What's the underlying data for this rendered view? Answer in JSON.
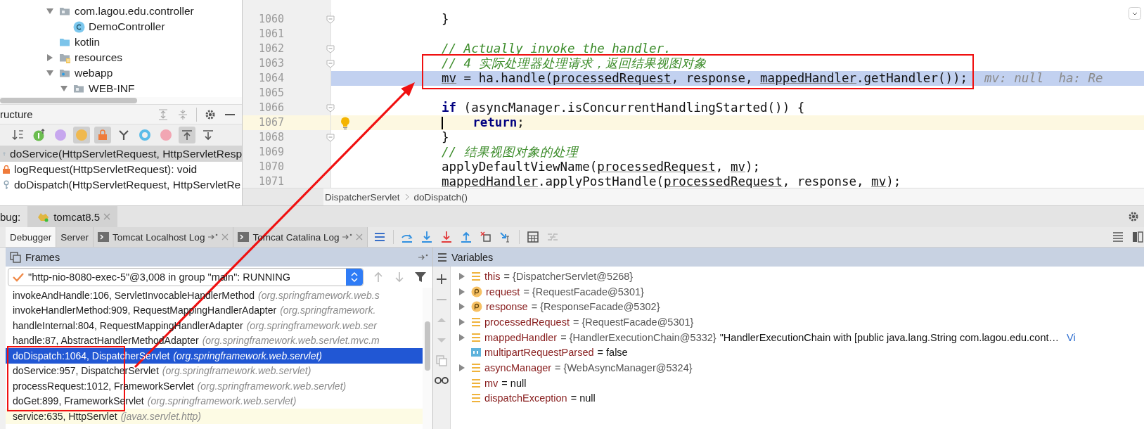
{
  "project_tree": {
    "items": [
      {
        "label": "com.lagou.edu.controller",
        "kind": "package",
        "expanded": true,
        "children": [
          {
            "label": "DemoController",
            "kind": "class"
          }
        ]
      },
      {
        "label": "kotlin",
        "kind": "folder"
      },
      {
        "label": "resources",
        "kind": "resources",
        "expanded": false
      },
      {
        "label": "webapp",
        "kind": "web",
        "expanded": true,
        "children": [
          {
            "label": "WEB-INF",
            "kind": "package",
            "expanded": true
          }
        ]
      }
    ]
  },
  "structure": {
    "title": "ructure",
    "toolbar": [
      {
        "kind": "sort",
        "on": false
      },
      {
        "kind": "inherited",
        "on": false
      },
      {
        "kind": "properties",
        "on": false
      },
      {
        "kind": "fields",
        "on": true
      },
      {
        "kind": "non-public",
        "on": true
      },
      {
        "kind": "anonymous",
        "on": false
      },
      {
        "kind": "interfaces",
        "on": false
      },
      {
        "kind": "lambdas",
        "on": false
      },
      {
        "kind": "scroll-to-source",
        "on": true
      },
      {
        "kind": "scroll-from-source",
        "on": false
      }
    ],
    "items": [
      {
        "label": "doService(HttpServletRequest, HttpServletResp",
        "kind": "package",
        "selected": true
      },
      {
        "label": "logRequest(HttpServletRequest): void",
        "kind": "private",
        "selected": false
      },
      {
        "label": "doDispatch(HttpServletRequest, HttpServletRe",
        "kind": "package",
        "selected": false
      }
    ]
  },
  "editor": {
    "lines": [
      {
        "number": "1060",
        "execution": false,
        "caret": false,
        "fold": true,
        "bulb": false,
        "annotated": false,
        "tokens": [
          {
            "text": "}",
            "kind": "plain"
          }
        ]
      },
      {
        "number": "1061",
        "execution": false,
        "caret": false,
        "fold": false,
        "bulb": false,
        "annotated": false
      },
      {
        "number": "1062",
        "execution": false,
        "caret": false,
        "fold": true,
        "bulb": false,
        "annotated": false,
        "tokens": [
          {
            "text": "// Actually invoke the handler.",
            "kind": "comment"
          }
        ]
      },
      {
        "number": "1063",
        "execution": false,
        "caret": false,
        "fold": true,
        "bulb": false,
        "annotated": true,
        "tokens": [
          {
            "text": "// 4 实际处理器处理请求，返回结果视图对象",
            "kind": "comment"
          }
        ]
      },
      {
        "number": "1064",
        "execution": true,
        "caret": false,
        "fold": false,
        "bulb": false,
        "annotated": true,
        "tokens": [
          {
            "text": "mv",
            "kind": "var"
          },
          {
            "text": " = ha.handle(",
            "kind": "plain"
          },
          {
            "text": "processedRequest",
            "kind": "var"
          },
          {
            "text": ", response, ",
            "kind": "plain"
          },
          {
            "text": "mappedHandler",
            "kind": "var"
          },
          {
            "text": ".getHandler());",
            "kind": "plain"
          }
        ],
        "hint": "mv: null  ha: Re"
      },
      {
        "number": "1065",
        "execution": false,
        "caret": false,
        "fold": false,
        "bulb": false,
        "annotated": false
      },
      {
        "number": "1066",
        "execution": false,
        "caret": false,
        "fold": true,
        "bulb": false,
        "annotated": false,
        "tokens": [
          {
            "text": "if",
            "kind": "keyword"
          },
          {
            "text": " (asyncManager.isConcurrentHandlingStarted()) {",
            "kind": "plain"
          }
        ]
      },
      {
        "number": "1067",
        "execution": false,
        "caret": true,
        "fold": false,
        "bulb": true,
        "annotated": false,
        "tokens": [
          {
            "text": "    return",
            "kind": "keyword"
          },
          {
            "text": ";",
            "kind": "plain"
          }
        ]
      },
      {
        "number": "1068",
        "execution": false,
        "caret": false,
        "fold": true,
        "bulb": false,
        "annotated": false,
        "tokens": [
          {
            "text": "}",
            "kind": "plain"
          }
        ]
      },
      {
        "number": "1069",
        "execution": false,
        "caret": false,
        "fold": false,
        "bulb": false,
        "annotated": false,
        "tokens": [
          {
            "text": "// 结果视图对象的处理",
            "kind": "comment"
          }
        ]
      },
      {
        "number": "1070",
        "execution": false,
        "caret": false,
        "fold": false,
        "bulb": false,
        "annotated": false,
        "tokens": [
          {
            "text": "applyDefaultViewName(",
            "kind": "plain"
          },
          {
            "text": "processedRequest",
            "kind": "var"
          },
          {
            "text": ", ",
            "kind": "plain"
          },
          {
            "text": "mv",
            "kind": "var"
          },
          {
            "text": ");",
            "kind": "plain"
          }
        ]
      },
      {
        "number": "1071",
        "execution": false,
        "caret": false,
        "fold": false,
        "bulb": false,
        "annotated": false,
        "tokens": [
          {
            "text": "mappedHandler",
            "kind": "var"
          },
          {
            "text": ".applyPostHandle(",
            "kind": "plain"
          },
          {
            "text": "processedRequest",
            "kind": "var"
          },
          {
            "text": ", response, ",
            "kind": "plain"
          },
          {
            "text": "mv",
            "kind": "var"
          },
          {
            "text": ");",
            "kind": "plain"
          }
        ]
      }
    ],
    "breadcrumb": [
      "DispatcherServlet",
      "doDispatch()"
    ]
  },
  "debug": {
    "title": "bug:",
    "session": "tomcat8.5",
    "tabs": [
      {
        "label": "Debugger",
        "kind": "plain",
        "selected": true
      },
      {
        "label": "Server",
        "kind": "plain",
        "selected": false
      },
      {
        "label": "Tomcat Localhost Log",
        "kind": "log",
        "selected": false
      },
      {
        "label": "Tomcat Catalina Log",
        "kind": "log",
        "selected": false
      }
    ],
    "frames": {
      "title": "Frames",
      "thread": "\"http-nio-8080-exec-5\"@3,008 in group \"main\": RUNNING",
      "items": [
        {
          "method": "invokeAndHandle:106, ServletInvocableHandlerMethod",
          "package": "(org.springframework.web.s",
          "selected": false,
          "library": false,
          "annotated": false
        },
        {
          "method": "invokeHandlerMethod:909, RequestMappingHandlerAdapter",
          "package": "(org.springframework.",
          "selected": false,
          "library": false,
          "annotated": false
        },
        {
          "method": "handleInternal:804, RequestMappingHandlerAdapter",
          "package": "(org.springframework.web.ser",
          "selected": false,
          "library": false,
          "annotated": false
        },
        {
          "method": "handle:87, AbstractHandlerMethodAdapter",
          "package": "(org.springframework.web.servlet.mvc.m",
          "selected": false,
          "library": false,
          "annotated": false
        },
        {
          "method": "doDispatch:1064, DispatcherServlet",
          "package": "(org.springframework.web.servlet)",
          "selected": true,
          "library": false,
          "annotated": true
        },
        {
          "method": "doService:957, DispatcherServlet",
          "package": "(org.springframework.web.servlet)",
          "selected": false,
          "library": false,
          "annotated": true
        },
        {
          "method": "processRequest:1012, FrameworkServlet",
          "package": "(org.springframework.web.servlet)",
          "selected": false,
          "library": false,
          "annotated": true
        },
        {
          "method": "doGet:899, FrameworkServlet",
          "package": "(org.springframework.web.servlet)",
          "selected": false,
          "library": false,
          "annotated": true
        },
        {
          "method": "service:635, HttpServlet",
          "package": "(javax.servlet.http)",
          "selected": false,
          "library": true,
          "annotated": false
        }
      ]
    },
    "variables": {
      "title": "Variables",
      "items": [
        {
          "name": "this",
          "value": "= {DispatcherServlet@5268}",
          "kind": "field",
          "object": true,
          "expandable": true
        },
        {
          "name": "request",
          "value": "= {RequestFacade@5301}",
          "kind": "param",
          "object": true,
          "expandable": true
        },
        {
          "name": "response",
          "value": "= {ResponseFacade@5302}",
          "kind": "param",
          "object": true,
          "expandable": true
        },
        {
          "name": "processedRequest",
          "value": "= {RequestFacade@5301}",
          "kind": "field",
          "object": true,
          "expandable": true
        },
        {
          "name": "mappedHandler",
          "value": "= {HandlerExecutionChain@5332}",
          "kind": "field",
          "object": true,
          "expandable": true,
          "description": "\"HandlerExecutionChain with [public java.lang.String com.lagou.edu.cont…",
          "link": "Vi"
        },
        {
          "name": "multipartRequestParsed",
          "value": "= false",
          "kind": "primitive",
          "object": false,
          "expandable": false
        },
        {
          "name": "asyncManager",
          "value": "= {WebAsyncManager@5324}",
          "kind": "field",
          "object": true,
          "expandable": true
        },
        {
          "name": "mv",
          "value": "= null",
          "kind": "field",
          "object": false,
          "expandable": false
        },
        {
          "name": "dispatchException",
          "value": "= null",
          "kind": "field",
          "object": false,
          "expandable": false
        }
      ]
    }
  }
}
